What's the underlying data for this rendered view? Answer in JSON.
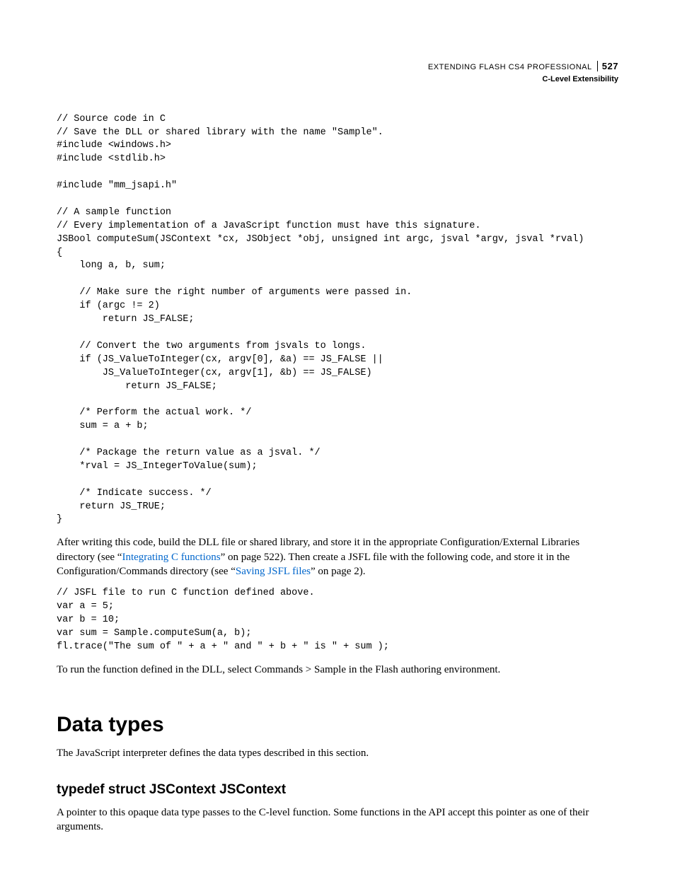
{
  "header": {
    "book_title": "EXTENDING FLASH CS4 PROFESSIONAL",
    "page_number": "527",
    "chapter": "C-Level Extensibility"
  },
  "code_block_1": "// Source code in C\n// Save the DLL or shared library with the name \"Sample\".\n#include <windows.h>\n#include <stdlib.h>\n\n#include \"mm_jsapi.h\"\n\n// A sample function\n// Every implementation of a JavaScript function must have this signature.\nJSBool computeSum(JSContext *cx, JSObject *obj, unsigned int argc, jsval *argv, jsval *rval)\n{\n    long a, b, sum;\n\n    // Make sure the right number of arguments were passed in.\n    if (argc != 2)\n        return JS_FALSE;\n\n    // Convert the two arguments from jsvals to longs.\n    if (JS_ValueToInteger(cx, argv[0], &a) == JS_FALSE ||\n        JS_ValueToInteger(cx, argv[1], &b) == JS_FALSE)\n            return JS_FALSE;\n\n    /* Perform the actual work. */\n    sum = a + b;\n\n    /* Package the return value as a jsval. */\n    *rval = JS_IntegerToValue(sum);\n\n    /* Indicate success. */\n    return JS_TRUE;\n}",
  "para1": {
    "pre": "After writing this code, build the DLL file or shared library, and store it in the appropriate Configuration/External Libraries directory (see “",
    "link1": "Integrating C functions",
    "mid": "” on page 522). Then create a JSFL file with the following code, and store it in the Configuration/Commands directory (see “",
    "link2": "Saving JSFL files",
    "post": "” on page 2)."
  },
  "code_block_2": "// JSFL file to run C function defined above.\nvar a = 5;\nvar b = 10;\nvar sum = Sample.computeSum(a, b);\nfl.trace(\"The sum of \" + a + \" and \" + b + \" is \" + sum );",
  "para2": "To run the function defined in the DLL, select Commands > Sample in the Flash authoring environment.",
  "section_heading": "Data types",
  "section_intro": "The JavaScript interpreter defines the data types described in this section.",
  "sub_heading": "typedef struct JSContext JSContext",
  "sub_body": "A pointer to this opaque data type passes to the C-level function. Some functions in the API accept this pointer as one of their arguments."
}
